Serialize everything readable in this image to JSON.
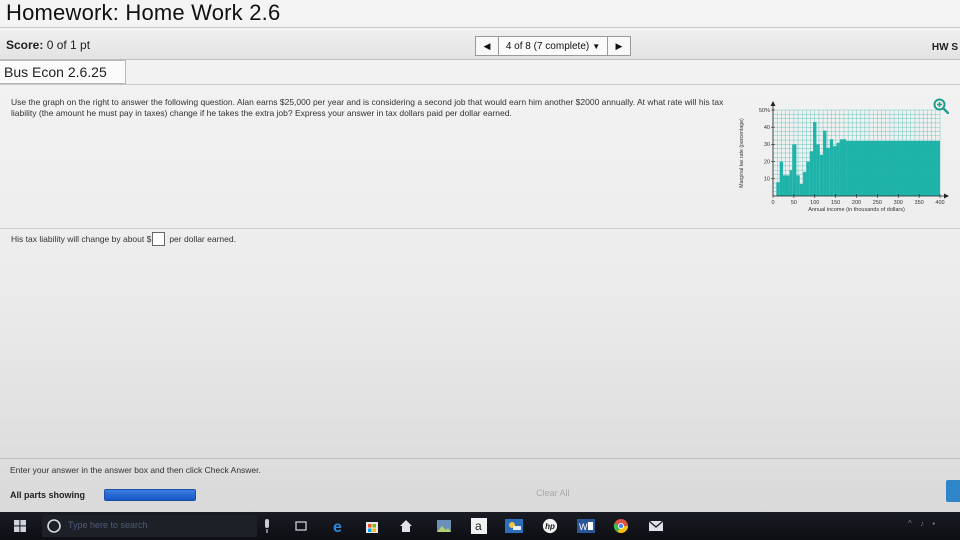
{
  "header": {
    "title": "Homework: Home Work 2.6",
    "score_label": "Score:",
    "score_value": "0 of 1 pt",
    "nav_label": "4 of 8 (7 complete)",
    "hw_score_label": "HW S"
  },
  "question": {
    "id": "Bus Econ 2.6.25",
    "text": "Use the graph on the right to answer the following question. Alan earns $25,000 per year and is considering a second job that would earn him another $2000 annually. At what rate will his tax liability (the amount he must pay in taxes) change if he takes the extra job? Express your answer in tax dollars paid per dollar earned.",
    "answer_prefix": "His tax liability will change by about $",
    "answer_value": "",
    "answer_suffix": "per dollar earned."
  },
  "footer": {
    "instruction": "Enter your answer in the answer box and then click Check Answer.",
    "parts_label": "All parts showing",
    "progress": 1.0,
    "clear_label": "Clear All"
  },
  "taskbar": {
    "search_placeholder": "Type here to search",
    "icons": [
      "windows-icon",
      "cortana-circle-icon",
      "mic-icon",
      "task-view-icon",
      "edge-icon",
      "store-icon",
      "home-icon",
      "photos-icon",
      "amazon-icon",
      "weather-icon",
      "hp-icon",
      "word-icon",
      "chrome-icon",
      "mail-icon"
    ]
  },
  "colors": {
    "bar_fill": "#1fb3a9",
    "grid": "#1fb3a9",
    "progress": "#1f5fcf",
    "accent_blue": "#2e86c8"
  },
  "chart_data": {
    "type": "bar",
    "title": "",
    "xlabel": "Annual income (in thousands of dollars)",
    "ylabel": "Marginal tax rate (percentage)",
    "ylim": [
      0,
      50
    ],
    "xlim": [
      0,
      400
    ],
    "x_ticks": [
      0,
      50,
      100,
      150,
      200,
      250,
      300,
      350,
      400
    ],
    "y_ticks": [
      10,
      20,
      30,
      40,
      50
    ],
    "y_tick_labels": [
      "10",
      "20",
      "30",
      "40",
      "50%"
    ],
    "grid": true,
    "steps": [
      {
        "from": 0,
        "to": 8,
        "value": 0
      },
      {
        "from": 8,
        "to": 16,
        "value": 8
      },
      {
        "from": 16,
        "to": 24,
        "value": 20
      },
      {
        "from": 24,
        "to": 40,
        "value": 12
      },
      {
        "from": 40,
        "to": 46,
        "value": 15
      },
      {
        "from": 46,
        "to": 56,
        "value": 30
      },
      {
        "from": 56,
        "to": 64,
        "value": 12
      },
      {
        "from": 64,
        "to": 72,
        "value": 7
      },
      {
        "from": 72,
        "to": 80,
        "value": 14
      },
      {
        "from": 80,
        "to": 88,
        "value": 20
      },
      {
        "from": 88,
        "to": 96,
        "value": 26
      },
      {
        "from": 96,
        "to": 104,
        "value": 43
      },
      {
        "from": 104,
        "to": 112,
        "value": 30
      },
      {
        "from": 112,
        "to": 120,
        "value": 24
      },
      {
        "from": 120,
        "to": 128,
        "value": 38
      },
      {
        "from": 128,
        "to": 136,
        "value": 28
      },
      {
        "from": 136,
        "to": 144,
        "value": 33
      },
      {
        "from": 144,
        "to": 152,
        "value": 29
      },
      {
        "from": 152,
        "to": 160,
        "value": 31
      },
      {
        "from": 160,
        "to": 175,
        "value": 33
      },
      {
        "from": 175,
        "to": 400,
        "value": 32
      }
    ]
  }
}
